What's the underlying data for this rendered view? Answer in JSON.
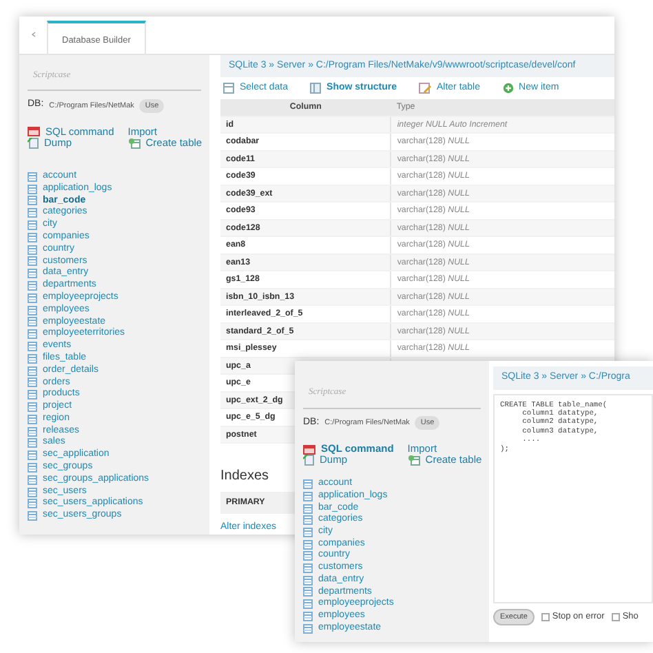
{
  "windows": [
    {
      "kind": "structure",
      "tabs": [
        {
          "label": "Database Builder",
          "selected": true
        }
      ],
      "sidebar": {
        "brand": "Scriptcase",
        "db_label": "DB:",
        "db_path": "C:/Program Files/NetMak",
        "use_button": "Use",
        "actions": [
          {
            "label": "SQL command",
            "kind": "sql",
            "selected": false
          },
          {
            "label": "Import",
            "kind": "plain",
            "selected": false
          },
          {
            "label": "Dump",
            "kind": "dump",
            "selected": false
          },
          {
            "label": "Create table",
            "kind": "create",
            "selected": false
          }
        ],
        "tables": [
          {
            "name": "account",
            "selected": false
          },
          {
            "name": "application_logs",
            "selected": false
          },
          {
            "name": "bar_code",
            "selected": true
          },
          {
            "name": "categories",
            "selected": false
          },
          {
            "name": "city",
            "selected": false
          },
          {
            "name": "companies",
            "selected": false
          },
          {
            "name": "country",
            "selected": false
          },
          {
            "name": "customers",
            "selected": false
          },
          {
            "name": "data_entry",
            "selected": false
          },
          {
            "name": "departments",
            "selected": false
          },
          {
            "name": "employeeprojects",
            "selected": false
          },
          {
            "name": "employees",
            "selected": false
          },
          {
            "name": "employeestate",
            "selected": false
          },
          {
            "name": "employeeterritories",
            "selected": false
          },
          {
            "name": "events",
            "selected": false
          },
          {
            "name": "files_table",
            "selected": false
          },
          {
            "name": "order_details",
            "selected": false
          },
          {
            "name": "orders",
            "selected": false
          },
          {
            "name": "products",
            "selected": false
          },
          {
            "name": "project",
            "selected": false
          },
          {
            "name": "region",
            "selected": false
          },
          {
            "name": "releases",
            "selected": false
          },
          {
            "name": "sales",
            "selected": false
          },
          {
            "name": "sec_application",
            "selected": false
          },
          {
            "name": "sec_groups",
            "selected": false
          },
          {
            "name": "sec_groups_applications",
            "selected": false
          },
          {
            "name": "sec_users",
            "selected": false
          },
          {
            "name": "sec_users_applications",
            "selected": false
          },
          {
            "name": "sec_users_groups",
            "selected": false
          }
        ]
      },
      "breadcrumb": "SQLite 3 » Server » C:/Program Files/NetMake/v9/wwwroot/scriptcase/devel/conf",
      "toolbar": [
        {
          "label": "Select data",
          "kind": "select",
          "selected": false
        },
        {
          "label": "Show structure",
          "kind": "structure",
          "selected": true
        },
        {
          "label": "Alter table",
          "kind": "alter",
          "selected": false
        },
        {
          "label": "New item",
          "kind": "new",
          "selected": false
        }
      ],
      "table": {
        "columns": [
          "Column",
          "Type"
        ],
        "rows": [
          {
            "column": "id",
            "type": "integer NULL Auto Increment",
            "kind": "auto"
          },
          {
            "column": "codabar",
            "type": "varchar(128) *NULL*",
            "kind": "plain"
          },
          {
            "column": "code11",
            "type": "varchar(128) *NULL*",
            "kind": "plain"
          },
          {
            "column": "code39",
            "type": "varchar(128) *NULL*",
            "kind": "plain"
          },
          {
            "column": "code39_ext",
            "type": "varchar(128) *NULL*",
            "kind": "plain"
          },
          {
            "column": "code93",
            "type": "varchar(128) *NULL*",
            "kind": "plain"
          },
          {
            "column": "code128",
            "type": "varchar(128) *NULL*",
            "kind": "plain"
          },
          {
            "column": "ean8",
            "type": "varchar(128) *NULL*",
            "kind": "plain"
          },
          {
            "column": "ean13",
            "type": "varchar(128) *NULL*",
            "kind": "plain"
          },
          {
            "column": "gs1_128",
            "type": "varchar(128) *NULL*",
            "kind": "plain"
          },
          {
            "column": "isbn_10_isbn_13",
            "type": "varchar(128) *NULL*",
            "kind": "plain"
          },
          {
            "column": "interleaved_2_of_5",
            "type": "varchar(128) *NULL*",
            "kind": "plain"
          },
          {
            "column": "standard_2_of_5",
            "type": "varchar(128) *NULL*",
            "kind": "plain"
          },
          {
            "column": "msi_plessey",
            "type": "varchar(128) *NULL*",
            "kind": "plain"
          },
          {
            "column": "upc_a"
          },
          {
            "column": "upc_e"
          },
          {
            "column": "upc_ext_2_dg"
          },
          {
            "column": "upc_e_5_dg"
          },
          {
            "column": "postnet"
          }
        ]
      },
      "indexes": {
        "title": "Indexes",
        "rows": [
          "PRIMARY"
        ],
        "link": "Alter indexes"
      }
    },
    {
      "kind": "sql",
      "sidebar": {
        "brand": "Scriptcase",
        "db_label": "DB:",
        "db_path": "C:/Program Files/NetMak",
        "use_button": "Use",
        "actions": [
          {
            "label": "SQL command",
            "kind": "sql",
            "selected": true
          },
          {
            "label": "Import",
            "kind": "plain",
            "selected": false
          },
          {
            "label": "Dump",
            "kind": "dump",
            "selected": false
          },
          {
            "label": "Create table",
            "kind": "create",
            "selected": false
          }
        ],
        "tables": [
          {
            "name": "account",
            "selected": false
          },
          {
            "name": "application_logs",
            "selected": false
          },
          {
            "name": "bar_code",
            "selected": false
          },
          {
            "name": "categories",
            "selected": false
          },
          {
            "name": "city",
            "selected": false
          },
          {
            "name": "companies",
            "selected": false
          },
          {
            "name": "country",
            "selected": false
          },
          {
            "name": "customers",
            "selected": false
          },
          {
            "name": "data_entry",
            "selected": false
          },
          {
            "name": "departments",
            "selected": false
          },
          {
            "name": "employeeprojects",
            "selected": false
          },
          {
            "name": "employees",
            "selected": false
          },
          {
            "name": "employeestate",
            "selected": false
          }
        ]
      },
      "breadcrumb": "SQLite 3 » Server » C:/Progra",
      "editor": {
        "value": "CREATE TABLE table_name(\n     column1 datatype,\n     column2 datatype,\n     column3 datatype,\n     ....\n);"
      },
      "execute_button": "Execute",
      "options": [
        {
          "label": "Stop on error",
          "checked": false
        },
        {
          "label": "Sho",
          "checked": false
        }
      ]
    }
  ]
}
